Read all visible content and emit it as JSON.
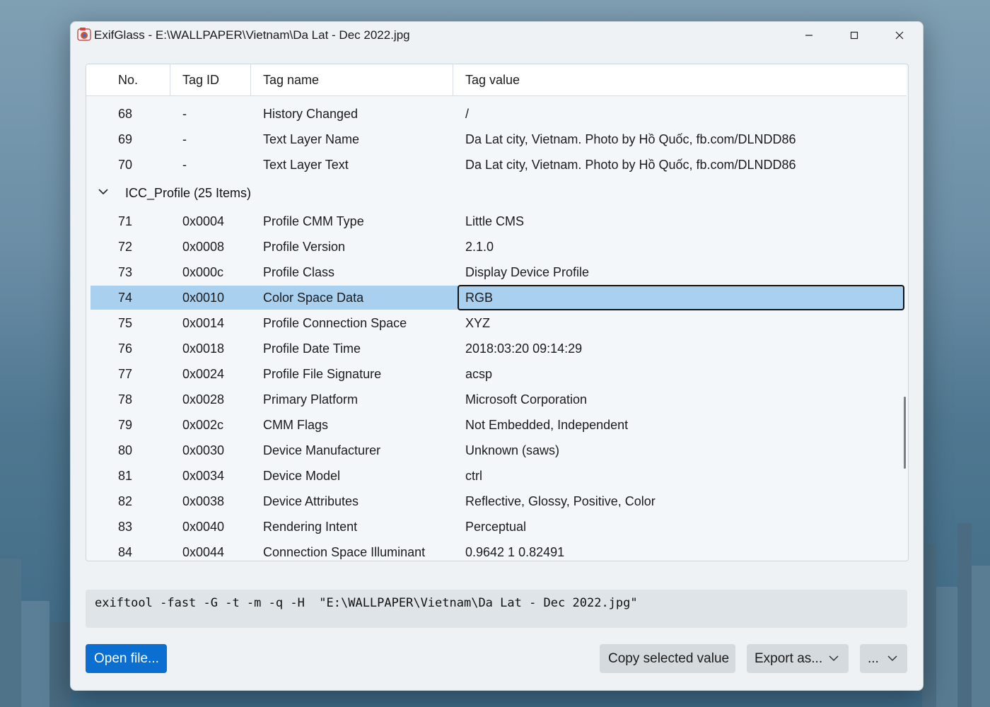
{
  "window": {
    "title": "ExifGlass - E:\\WALLPAPER\\Vietnam\\Da Lat - Dec 2022.jpg",
    "controls": {
      "minimize": "—",
      "maximize": "□",
      "close": "✕"
    }
  },
  "table": {
    "columns": {
      "no": "No.",
      "tag_id": "Tag ID",
      "tag_name": "Tag name",
      "tag_value": "Tag value"
    },
    "rows_before_group": [
      {
        "no": "68",
        "tag_id": "-",
        "tag_name": "History Changed",
        "tag_value": "/"
      },
      {
        "no": "69",
        "tag_id": "-",
        "tag_name": "Text Layer Name",
        "tag_value": "Da Lat city, Vietnam. Photo by Hồ Quốc, fb.com/DLNDD86"
      },
      {
        "no": "70",
        "tag_id": "-",
        "tag_name": "Text Layer Text",
        "tag_value": "Da Lat city, Vietnam. Photo by Hồ Quốc, fb.com/DLNDD86"
      }
    ],
    "group": {
      "label": "ICC_Profile (25 Items)",
      "expanded": true
    },
    "group_rows": [
      {
        "no": "71",
        "tag_id": "0x0004",
        "tag_name": "Profile CMM Type",
        "tag_value": "Little CMS"
      },
      {
        "no": "72",
        "tag_id": "0x0008",
        "tag_name": "Profile Version",
        "tag_value": "2.1.0"
      },
      {
        "no": "73",
        "tag_id": "0x000c",
        "tag_name": "Profile Class",
        "tag_value": "Display Device Profile"
      },
      {
        "no": "74",
        "tag_id": "0x0010",
        "tag_name": "Color Space Data",
        "tag_value": "RGB",
        "selected": true
      },
      {
        "no": "75",
        "tag_id": "0x0014",
        "tag_name": "Profile Connection Space",
        "tag_value": "XYZ"
      },
      {
        "no": "76",
        "tag_id": "0x0018",
        "tag_name": "Profile Date Time",
        "tag_value": "2018:03:20 09:14:29"
      },
      {
        "no": "77",
        "tag_id": "0x0024",
        "tag_name": "Profile File Signature",
        "tag_value": "acsp"
      },
      {
        "no": "78",
        "tag_id": "0x0028",
        "tag_name": "Primary Platform",
        "tag_value": "Microsoft Corporation"
      },
      {
        "no": "79",
        "tag_id": "0x002c",
        "tag_name": "CMM Flags",
        "tag_value": "Not Embedded, Independent"
      },
      {
        "no": "80",
        "tag_id": "0x0030",
        "tag_name": "Device Manufacturer",
        "tag_value": "Unknown (saws)"
      },
      {
        "no": "81",
        "tag_id": "0x0034",
        "tag_name": "Device Model",
        "tag_value": "ctrl"
      },
      {
        "no": "82",
        "tag_id": "0x0038",
        "tag_name": "Device Attributes",
        "tag_value": "Reflective, Glossy, Positive, Color"
      },
      {
        "no": "83",
        "tag_id": "0x0040",
        "tag_name": "Rendering Intent",
        "tag_value": "Perceptual"
      },
      {
        "no": "84",
        "tag_id": "0x0044",
        "tag_name": "Connection Space Illuminant",
        "tag_value": "0.9642 1 0.82491"
      }
    ]
  },
  "command": {
    "text": "exiftool -fast -G -t -m -q -H  \"E:\\WALLPAPER\\Vietnam\\Da Lat - Dec 2022.jpg\""
  },
  "footer": {
    "open_label": "Open file...",
    "copy_label": "Copy selected value",
    "export_label": "Export as...",
    "more_label": "..."
  },
  "colors": {
    "accent": "#0a6fd0",
    "selection": "#a9d0ef"
  },
  "icons": {
    "app": "exifglass-app-icon",
    "group_toggle": "chevron-down-icon",
    "dropdown": "chevron-down-icon"
  }
}
